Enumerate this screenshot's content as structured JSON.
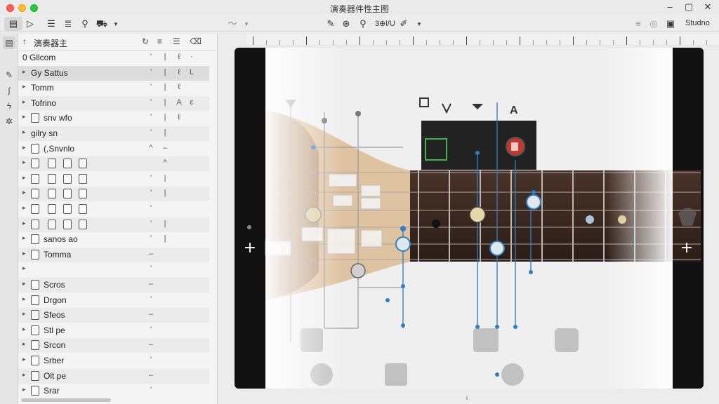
{
  "window": {
    "title": "演奏器件性主图",
    "controls": {
      "minimize": "–",
      "maximize": "▢",
      "close": "✕"
    }
  },
  "toolbar": {
    "left_tools": [
      {
        "icon": "document-icon",
        "glyph": "▤"
      },
      {
        "icon": "play-icon",
        "glyph": "▷"
      },
      {
        "icon": "list-icon",
        "glyph": "☰"
      },
      {
        "icon": "equalizer-icon",
        "glyph": "≣"
      },
      {
        "icon": "search-icon",
        "glyph": "⚲"
      },
      {
        "icon": "car-icon",
        "glyph": "⛟"
      }
    ],
    "center_tools": [
      {
        "icon": "pen-tool-icon",
        "glyph": "✎"
      },
      {
        "icon": "tuner-icon",
        "glyph": "⊕"
      },
      {
        "icon": "pin-icon",
        "glyph": "⚲"
      },
      {
        "icon": "split-icon",
        "glyph": "⇅"
      },
      {
        "icon": "stamp-icon",
        "glyph": "✐"
      }
    ],
    "center_label": "3⊕l/U",
    "right_label": "Studno"
  },
  "panel": {
    "title": "演奏器主",
    "rows": [
      {
        "name": "0 Gllcom",
        "cols": [
          "'",
          "|",
          "ℓ",
          "·"
        ]
      },
      {
        "name": "Gy Sattus",
        "cols": [
          "'",
          "|",
          "ℓ",
          "L"
        ]
      },
      {
        "name": "Tomm",
        "cols": [
          "'",
          "|",
          "ℓ",
          ""
        ]
      },
      {
        "name": "Tofrino",
        "cols": [
          "'",
          "|",
          "A",
          "ε"
        ]
      },
      {
        "name": "snv wfo",
        "cols": [
          "'",
          "|",
          "ℓ",
          ""
        ]
      },
      {
        "name": "gilry sn",
        "cols": [
          "'",
          "|",
          "",
          ""
        ]
      },
      {
        "name": "(,Snvnlo",
        "cols": [
          "^",
          "–",
          "",
          ""
        ]
      },
      {
        "name": "",
        "cols": [
          "",
          "^",
          "",
          ""
        ]
      },
      {
        "name": "",
        "cols": [
          "'",
          "|",
          "",
          ""
        ]
      },
      {
        "name": "",
        "cols": [
          "'",
          "|",
          "",
          ""
        ]
      },
      {
        "name": "",
        "cols": [
          "'",
          "",
          "",
          ""
        ]
      },
      {
        "name": "",
        "cols": [
          "'",
          "|",
          "",
          ""
        ]
      },
      {
        "name": "sanos ao",
        "cols": [
          "'",
          "|",
          "",
          ""
        ]
      },
      {
        "name": "Tomma",
        "cols": [
          "–",
          "",
          "",
          ""
        ]
      },
      {
        "name": "",
        "cols": [
          "'",
          "",
          "",
          ""
        ]
      },
      {
        "name": "Scros",
        "cols": [
          "–",
          "",
          "",
          ""
        ]
      },
      {
        "name": "Drgon",
        "cols": [
          "'",
          "",
          "",
          ""
        ]
      },
      {
        "name": "Sfeos",
        "cols": [
          "–",
          "",
          "",
          ""
        ]
      },
      {
        "name": "Stl pe",
        "cols": [
          "'",
          "",
          "",
          ""
        ]
      },
      {
        "name": "Srcon",
        "cols": [
          "–",
          "",
          "",
          ""
        ]
      },
      {
        "name": "Srber",
        "cols": [
          "'",
          "",
          "",
          ""
        ]
      },
      {
        "name": "Olt pe",
        "cols": [
          "–",
          "",
          "",
          ""
        ]
      },
      {
        "name": "Srar",
        "cols": [
          "'",
          "",
          "",
          ""
        ]
      }
    ]
  },
  "canvas": {
    "add_left": "+",
    "add_right": "+",
    "bottom_marker": "ι"
  },
  "colors": {
    "accent_blue": "#2f7fc1",
    "fret_brown": "#3b2820",
    "neck_wood": "#d9b487",
    "green_marker": "#3fb34f",
    "red_marker": "#c0392b"
  }
}
